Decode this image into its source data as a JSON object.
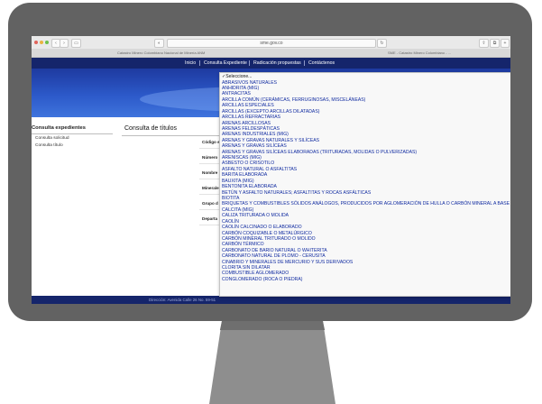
{
  "browser": {
    "url": "sme.gov.co",
    "tab_left": "Catastro Minero Colombiano Nacional de Minería ANM",
    "tab_right": "SME - Catastro Minero Colombiano - ..."
  },
  "nav": {
    "items": [
      "Inicio",
      "Consulta Expediente",
      "Radicación propuestas",
      "Contáctenos"
    ]
  },
  "sidebar": {
    "title": "Consulta expedientes",
    "links": [
      "Consulta solicitud",
      "Consulta título"
    ]
  },
  "main": {
    "title": "Consulta de títulos",
    "fields": [
      "Código e",
      "Número",
      "Nombre",
      "Minerale",
      "Grupo d",
      "Departa"
    ]
  },
  "footer": {
    "text": "Dirección: Avenida Calle 26 No. 59-51"
  },
  "dropdown": {
    "selected": "✓Seleccione...",
    "options": [
      "ABRASIVOS NATURALES",
      "ANHIDRITA (MIG)",
      "ANTRACITAS",
      "ARCILLA COMÚN (CERÁMICAS, FERRUGINOSAS, MISCELÁNEAS)",
      "ARCILLAS ESPECIALES",
      "ARCILLAS (EXCEPTO ARCILLAS DILATADAS)",
      "ARCILLAS REFRACTARIAS",
      "ARENAS ARCILLOSAS",
      "ARENAS FELDESPÁTICAS",
      "ARENAS INDUSTRIALES (MIG)",
      "ARENAS Y GRAVAS NATURALES Y SILÍCEAS",
      "ARENAS Y GRAVAS SILÍCEAS",
      "ARENAS Y GRAVAS SILÍCEAS ELABORADAS (TRITURADAS, MOLIDAS O PULVERIZADAS)",
      "ARENISCAS (MIG)",
      "ASBESTO O CRISOTILO",
      "ASFALTO NATURAL O ASFALTITAS",
      "BARITA ELABORADA",
      "BAUXITA (MIG)",
      "BENTONITA ELABORADA",
      "BETÚN Y ASFALTO NATURALES; ASFALTITAS Y ROCAS ASFÁLTICAS",
      "BIOTITA",
      "BRIQUETAS Y COMBUSTIBLES SÓLIDOS ANÁLOGOS, PRODUCIDOS POR AGLOMERACIÓN DE HULLA O CARBÓN MINERAL A BASE",
      "CALCITA (MIG)",
      "CALIZA TRITURADA O MOLIDA",
      "CAOLÍN",
      "CAOLÍN CALCINADO O ELABORADO",
      "CARBÓN COQUIZABLE O METALÚRGICO",
      "CARBÓN MINERAL TRITURADO O MOLIDO",
      "CARBÓN TÉRMICO",
      "CARBONATO DE BARIO NATURAL O WHITERITA",
      "CARBONATO NATURAL DE PLOMO - CERUSITA",
      "CINABRIO Y MINERALES DE MERCURIO Y SUS DERIVADOS",
      "CLORITA SIN DILATAR",
      "COMBUSTIBLE AGLOMERADO",
      "CONGLOMERADO (ROCA O PIEDRA)"
    ]
  }
}
